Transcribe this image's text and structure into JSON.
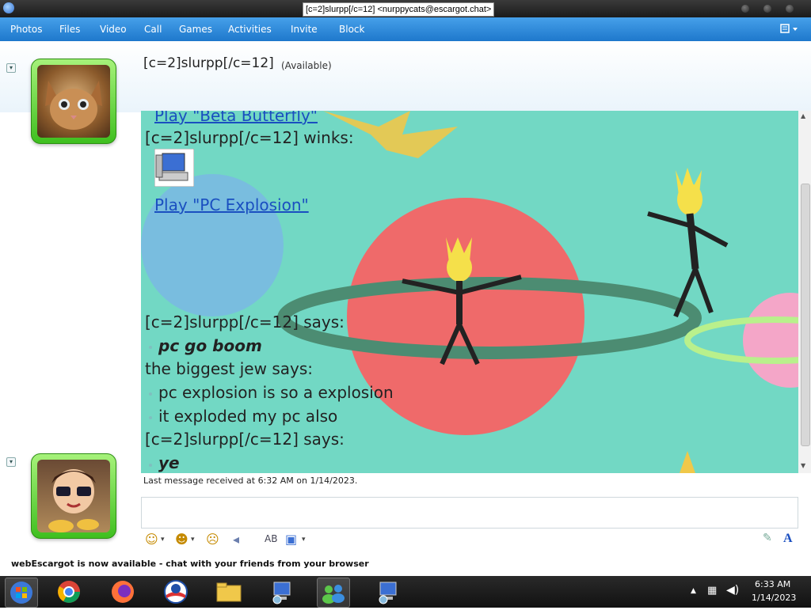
{
  "window": {
    "title": "[c=2]slurpp[/c=12] <nurppycats@escargot.chat>"
  },
  "menu": {
    "items": [
      "Photos",
      "Files",
      "Video",
      "Call",
      "Games",
      "Activities",
      "Invite",
      "Block"
    ],
    "options_icon": "menu-options-icon"
  },
  "contact": {
    "name": "[c=2]slurpp[/c=12]",
    "status": "(Available)"
  },
  "chat": {
    "messages": [
      {
        "kind": "link",
        "text": "Play \"Beta Butterfly\""
      },
      {
        "kind": "name",
        "text": "[c=2]slurpp[/c=12] winks:"
      },
      {
        "kind": "link",
        "text": "Play \"PC Explosion\""
      },
      {
        "kind": "name",
        "text": "[c=2]slurpp[/c=12] says:"
      },
      {
        "kind": "bold",
        "text": "pc go boom"
      },
      {
        "kind": "name",
        "text": "the biggest jew says:"
      },
      {
        "kind": "line",
        "text": "pc explosion is so a explosion"
      },
      {
        "kind": "line",
        "text": "it exploded my pc also"
      },
      {
        "kind": "name",
        "text": "[c=2]slurpp[/c=12] says:"
      },
      {
        "kind": "bold",
        "text": "ye"
      }
    ]
  },
  "last_message": "Last message received at 6:32 AM on 1/14/2023.",
  "status_bar": "webEscargot is now available - chat with your friends from your browser",
  "taskbar": {
    "time": "6:33 AM",
    "date": "1/14/2023"
  },
  "colors": {
    "menubar": "#2b86d6",
    "chat_bg": "#72d8c4",
    "link": "#1a4fc0"
  }
}
